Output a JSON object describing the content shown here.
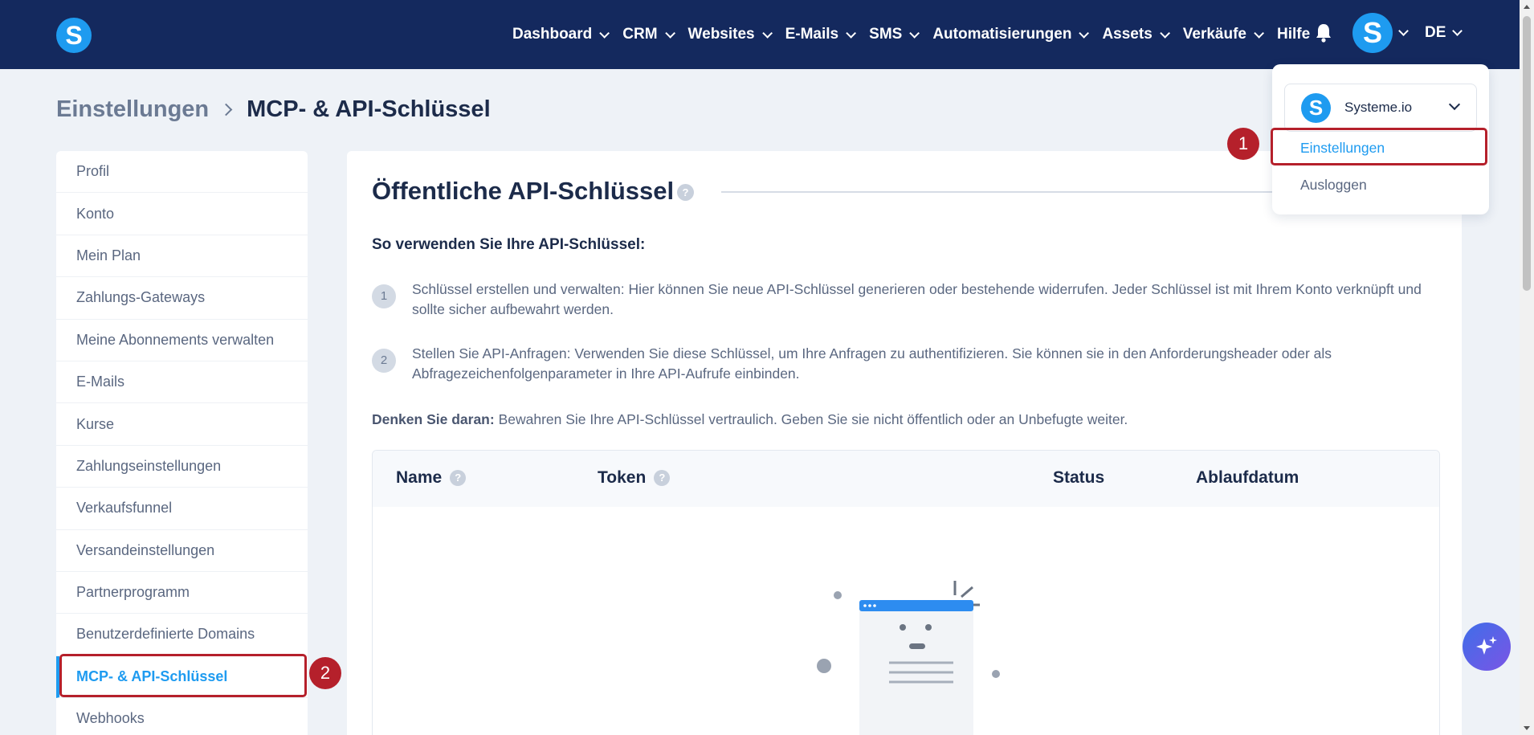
{
  "app": {
    "logo_letter": "S"
  },
  "nav": {
    "items": [
      {
        "label": "Dashboard",
        "has_dropdown": true
      },
      {
        "label": "CRM",
        "has_dropdown": true
      },
      {
        "label": "Websites",
        "has_dropdown": true
      },
      {
        "label": "E-Mails",
        "has_dropdown": true
      },
      {
        "label": "SMS",
        "has_dropdown": true
      },
      {
        "label": "Automatisierungen",
        "has_dropdown": true
      },
      {
        "label": "Assets",
        "has_dropdown": true
      },
      {
        "label": "Verkäufe",
        "has_dropdown": true
      },
      {
        "label": "Hilfe",
        "has_dropdown": false
      }
    ],
    "avatar_letter": "S",
    "language": "DE",
    "icons": [
      "bell-icon",
      "chevron-down-icon"
    ]
  },
  "breadcrumb": {
    "root": "Einstellungen",
    "current": "MCP- & API-Schlüssel"
  },
  "sidebar": {
    "items": [
      {
        "label": "Profil"
      },
      {
        "label": "Konto"
      },
      {
        "label": "Mein Plan"
      },
      {
        "label": "Zahlungs-Gateways"
      },
      {
        "label": "Meine Abonnements verwalten"
      },
      {
        "label": "E-Mails"
      },
      {
        "label": "Kurse"
      },
      {
        "label": "Zahlungseinstellungen"
      },
      {
        "label": "Verkaufsfunnel"
      },
      {
        "label": "Versandeinstellungen"
      },
      {
        "label": "Partnerprogramm"
      },
      {
        "label": "Benutzerdefinierte Domains"
      },
      {
        "label": "MCP- & API-Schlüssel",
        "active": true
      },
      {
        "label": "Webhooks"
      }
    ]
  },
  "main": {
    "title": "Öffentliche API-Schlüssel",
    "howto_heading": "So verwenden Sie Ihre API-Schlüssel:",
    "steps": [
      {
        "num": "1",
        "text": "Schlüssel erstellen und verwalten: Hier können Sie neue API-Schlüssel generieren oder bestehende widerrufen. Jeder Schlüssel ist mit Ihrem Konto verknüpft und sollte sicher aufbewahrt werden."
      },
      {
        "num": "2",
        "text": "Stellen Sie API-Anfragen: Verwenden Sie diese Schlüssel, um Ihre Anfragen zu authentifizieren. Sie können sie in den Anforderungsheader oder als Abfragezeichenfolgenparameter in Ihre API-Aufrufe einbinden."
      }
    ],
    "reminder_bold": "Denken Sie daran:",
    "reminder_text": " Bewahren Sie Ihre API-Schlüssel vertraulich. Geben Sie sie nicht öffentlich oder an Unbefugte weiter.",
    "table": {
      "columns": [
        "Name",
        "Token",
        "Status",
        "Ablaufdatum"
      ]
    },
    "help_glyph": "?"
  },
  "dropdown": {
    "account_letter": "S",
    "account_name": "Systeme.io",
    "items": [
      "Einstellungen",
      "Ausloggen"
    ]
  },
  "annotations": {
    "badge1": "1",
    "badge2": "2"
  },
  "colors": {
    "nav_bg": "#14295e",
    "accent": "#1e9bf0",
    "highlight": "#b5202b",
    "page_bg": "#eef2f7"
  }
}
